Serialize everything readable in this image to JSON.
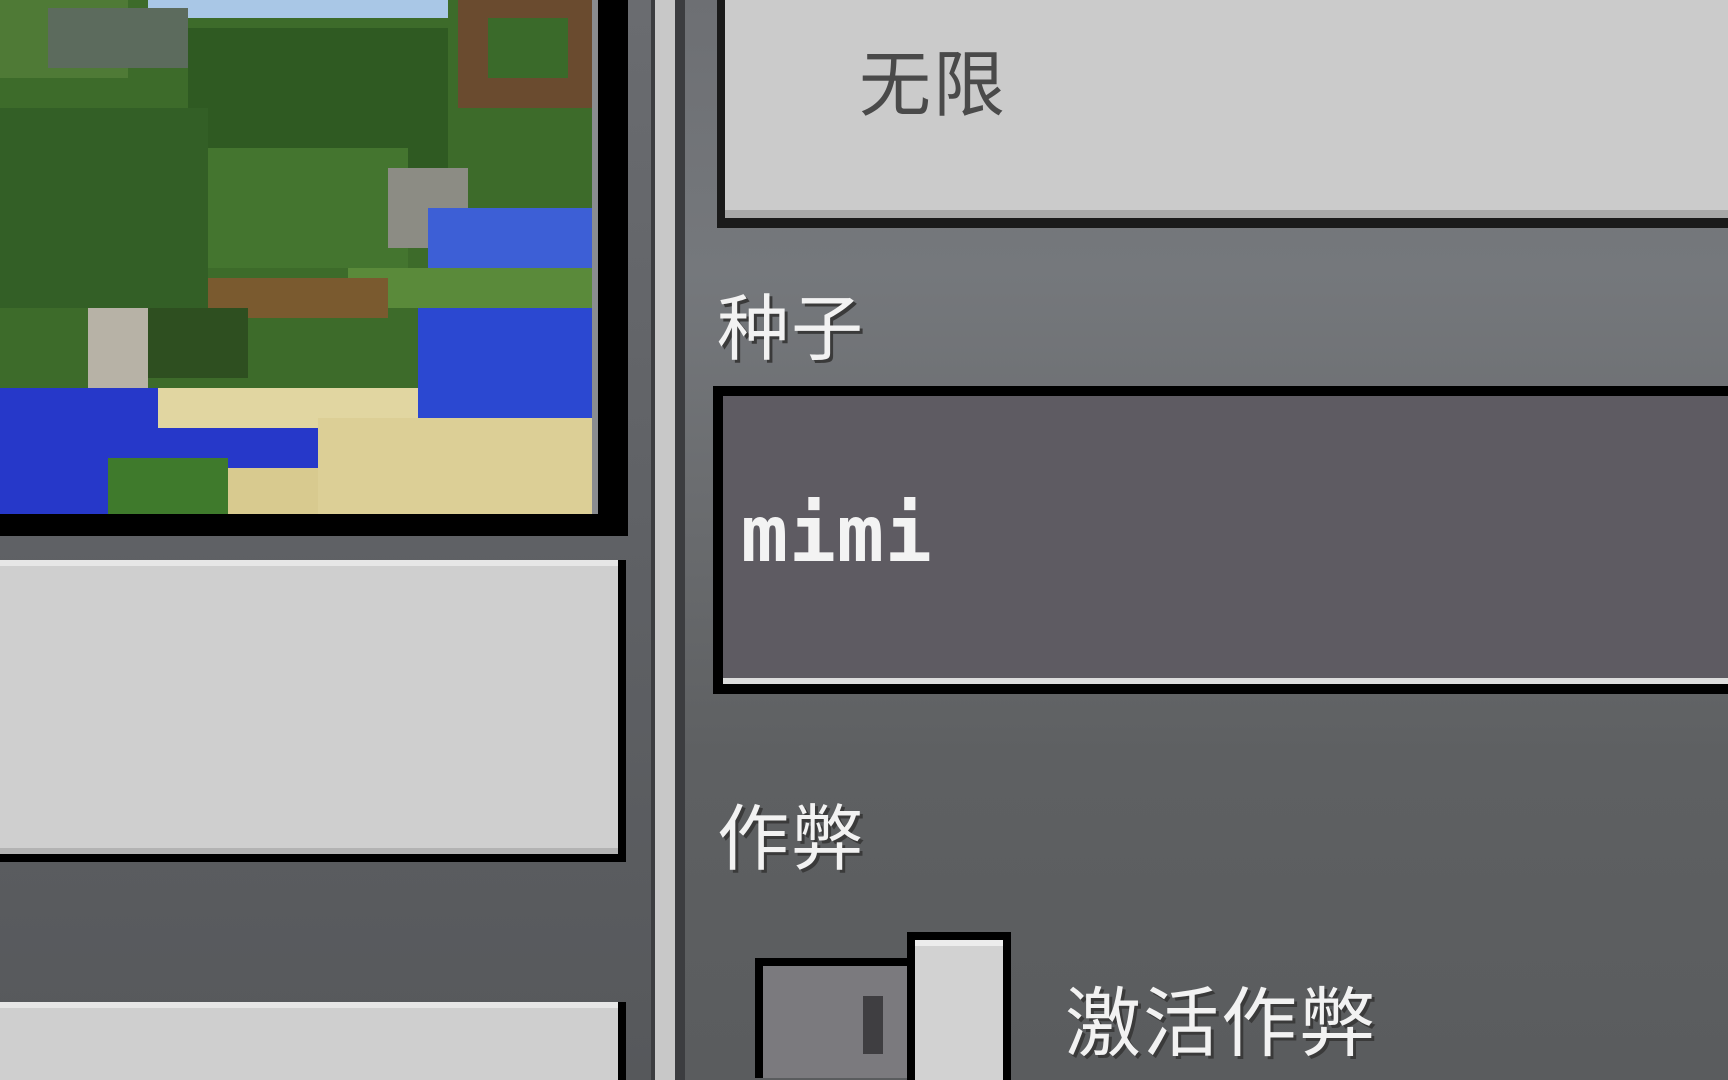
{
  "world_options": {
    "world_type_value": "无限",
    "seed": {
      "label": "种子",
      "value": "mimi"
    },
    "cheats": {
      "label": "作弊",
      "toggle_label": "激活作弊",
      "enabled": false
    }
  },
  "colors": {
    "panel_grey": "#6d6f73",
    "button_face": "#cfcfcf",
    "input_face": "#5e5b62",
    "label_text": "#f2f2f2"
  }
}
